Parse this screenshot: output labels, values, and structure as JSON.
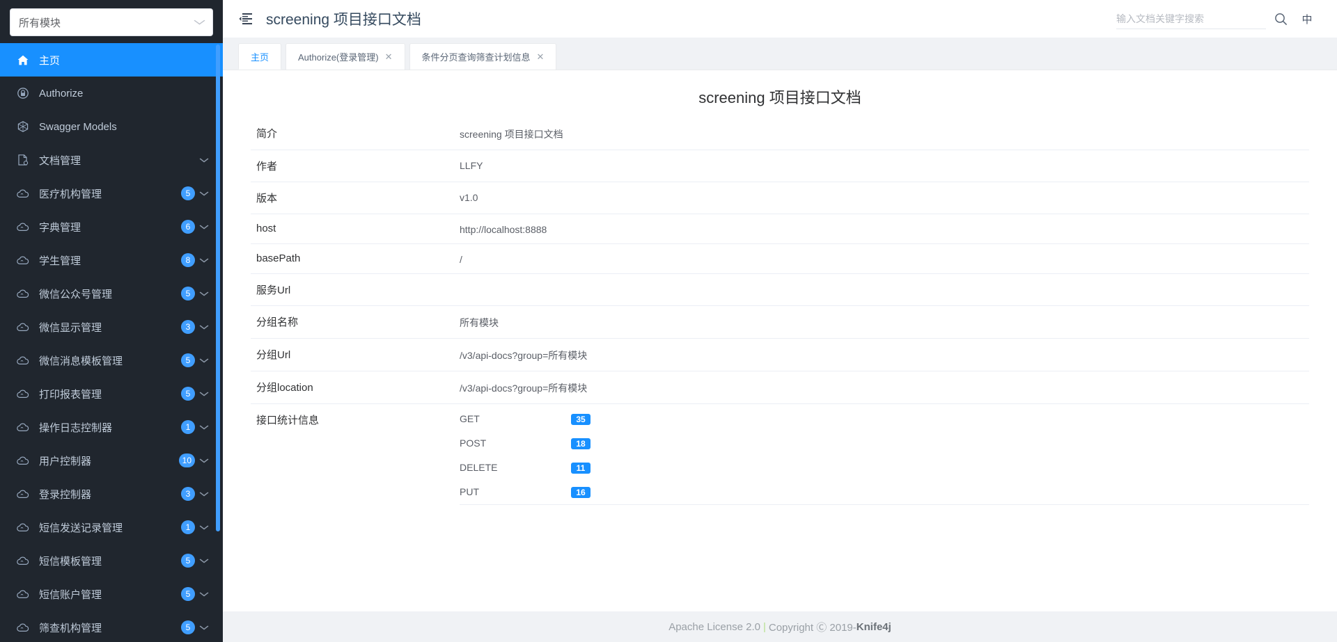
{
  "sidebar": {
    "group_select": {
      "value": "所有模块",
      "icon": "chevron-down-icon"
    },
    "items": [
      {
        "label": "主页",
        "icon": "home-icon",
        "active": true,
        "badge": null,
        "expandable": false
      },
      {
        "label": "Authorize",
        "icon": "lock-icon",
        "active": false,
        "badge": null,
        "expandable": false
      },
      {
        "label": "Swagger Models",
        "icon": "cube-icon",
        "active": false,
        "badge": null,
        "expandable": false
      },
      {
        "label": "文档管理",
        "icon": "document-icon",
        "active": false,
        "badge": null,
        "expandable": true
      },
      {
        "label": "医疗机构管理",
        "icon": "cloud-icon",
        "active": false,
        "badge": "5",
        "expandable": true
      },
      {
        "label": "字典管理",
        "icon": "cloud-icon",
        "active": false,
        "badge": "6",
        "expandable": true
      },
      {
        "label": "学生管理",
        "icon": "cloud-icon",
        "active": false,
        "badge": "8",
        "expandable": true
      },
      {
        "label": "微信公众号管理",
        "icon": "cloud-icon",
        "active": false,
        "badge": "5",
        "expandable": true
      },
      {
        "label": "微信显示管理",
        "icon": "cloud-icon",
        "active": false,
        "badge": "3",
        "expandable": true
      },
      {
        "label": "微信消息模板管理",
        "icon": "cloud-icon",
        "active": false,
        "badge": "5",
        "expandable": true
      },
      {
        "label": "打印报表管理",
        "icon": "cloud-icon",
        "active": false,
        "badge": "5",
        "expandable": true
      },
      {
        "label": "操作日志控制器",
        "icon": "cloud-icon",
        "active": false,
        "badge": "1",
        "expandable": true
      },
      {
        "label": "用户控制器",
        "icon": "cloud-icon",
        "active": false,
        "badge": "10",
        "expandable": true
      },
      {
        "label": "登录控制器",
        "icon": "cloud-icon",
        "active": false,
        "badge": "3",
        "expandable": true
      },
      {
        "label": "短信发送记录管理",
        "icon": "cloud-icon",
        "active": false,
        "badge": "1",
        "expandable": true
      },
      {
        "label": "短信模板管理",
        "icon": "cloud-icon",
        "active": false,
        "badge": "5",
        "expandable": true
      },
      {
        "label": "短信账户管理",
        "icon": "cloud-icon",
        "active": false,
        "badge": "5",
        "expandable": true
      },
      {
        "label": "筛查机构管理",
        "icon": "cloud-icon",
        "active": false,
        "badge": "5",
        "expandable": true
      }
    ]
  },
  "topbar": {
    "fold_icon": "menu-fold-icon",
    "title": "screening 项目接口文档",
    "search": {
      "placeholder": "输入文档关键字搜索",
      "value": "",
      "icon": "search-icon"
    },
    "lang_label": "中"
  },
  "tabs": [
    {
      "label": "主页",
      "active": true,
      "closable": false
    },
    {
      "label": "Authorize(登录管理)",
      "active": false,
      "closable": true,
      "close_icon": "close-icon"
    },
    {
      "label": "条件分页查询筛查计划信息",
      "active": false,
      "closable": true,
      "close_icon": "close-icon"
    }
  ],
  "document": {
    "title": "screening 项目接口文档",
    "rows": [
      {
        "key": "简介",
        "value": "screening 项目接口文档"
      },
      {
        "key": "作者",
        "value": "LLFY"
      },
      {
        "key": "版本",
        "value": "v1.0"
      },
      {
        "key": "host",
        "value": "http://localhost:8888"
      },
      {
        "key": "basePath",
        "value": "/"
      },
      {
        "key": "服务Url",
        "value": ""
      },
      {
        "key": "分组名称",
        "value": "所有模块"
      },
      {
        "key": "分组Url",
        "value": "/v3/api-docs?group=所有模块"
      },
      {
        "key": "分组location",
        "value": "/v3/api-docs?group=所有模块"
      }
    ],
    "stats_label": "接口统计信息",
    "stats": [
      {
        "method": "GET",
        "count": "35"
      },
      {
        "method": "POST",
        "count": "18"
      },
      {
        "method": "DELETE",
        "count": "11"
      },
      {
        "method": "PUT",
        "count": "16"
      }
    ]
  },
  "footer": {
    "license": "Apache License 2.0",
    "separator": "|",
    "copyright": "Copyright Ⓒ 2019-",
    "brand": "Knife4j"
  },
  "colors": {
    "sidebar_bg": "#20262e",
    "accent": "#1890ff",
    "badge": "#409eff",
    "content_bg": "#f0f2f5"
  }
}
